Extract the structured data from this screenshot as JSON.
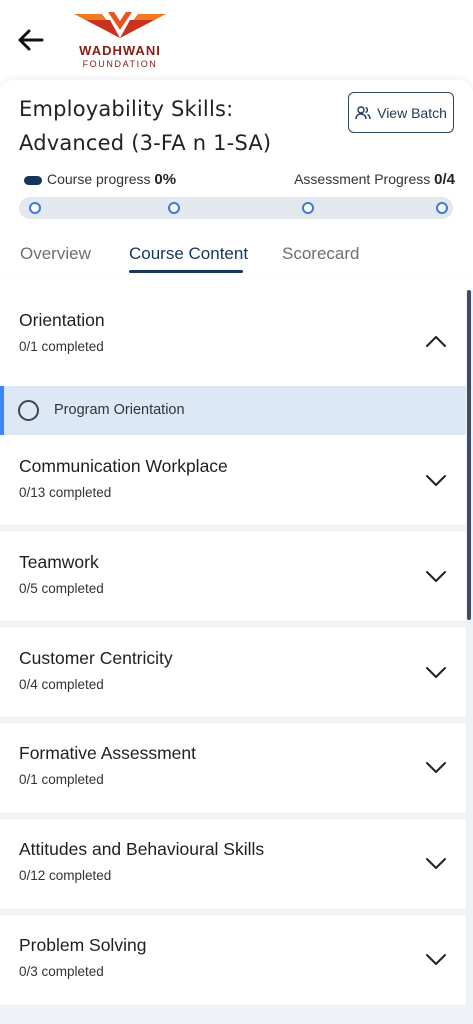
{
  "logo": {
    "name": "WADHWANI",
    "sub": "FOUNDATION",
    "colors": {
      "orange": "#f07a22",
      "red": "#8a1c14"
    }
  },
  "header": {
    "title": "Employability Skills: Advanced (3-FA n 1-SA)",
    "view_batch_label": "View Batch"
  },
  "progress": {
    "course_label": "Course progress",
    "course_value": "0%",
    "course_fraction": 0,
    "assessment_label": "Assessment Progress",
    "assessment_value": "0/4",
    "assessment_done": 0,
    "assessment_total": 4
  },
  "tabs": [
    {
      "label": "Overview",
      "active": false
    },
    {
      "label": "Course Content",
      "active": true
    },
    {
      "label": "Scorecard",
      "active": false
    }
  ],
  "sections": [
    {
      "title": "Orientation",
      "status": "0/1 completed",
      "expanded": true,
      "lessons": [
        {
          "label": "Program Orientation",
          "done": false
        }
      ]
    },
    {
      "title": "Communication Workplace",
      "status": "0/13 completed",
      "expanded": false
    },
    {
      "title": "Teamwork",
      "status": "0/5 completed",
      "expanded": false
    },
    {
      "title": "Customer Centricity",
      "status": "0/4 completed",
      "expanded": false
    },
    {
      "title": "Formative Assessment",
      "status": "0/1 completed",
      "expanded": false
    },
    {
      "title": "Attitudes and Behavioural Skills",
      "status": "0/12 completed",
      "expanded": false
    },
    {
      "title": "Problem Solving",
      "status": "0/3 completed",
      "expanded": false
    }
  ],
  "colors": {
    "accent": "#16365b",
    "track": "#e3e8ef",
    "dot": "#3a7bd5",
    "highlight": "#dde8f6"
  },
  "icons": {
    "back": "arrow-left-icon",
    "batch": "users-icon",
    "expand": "chevron-down-icon",
    "collapse": "chevron-up-icon"
  }
}
